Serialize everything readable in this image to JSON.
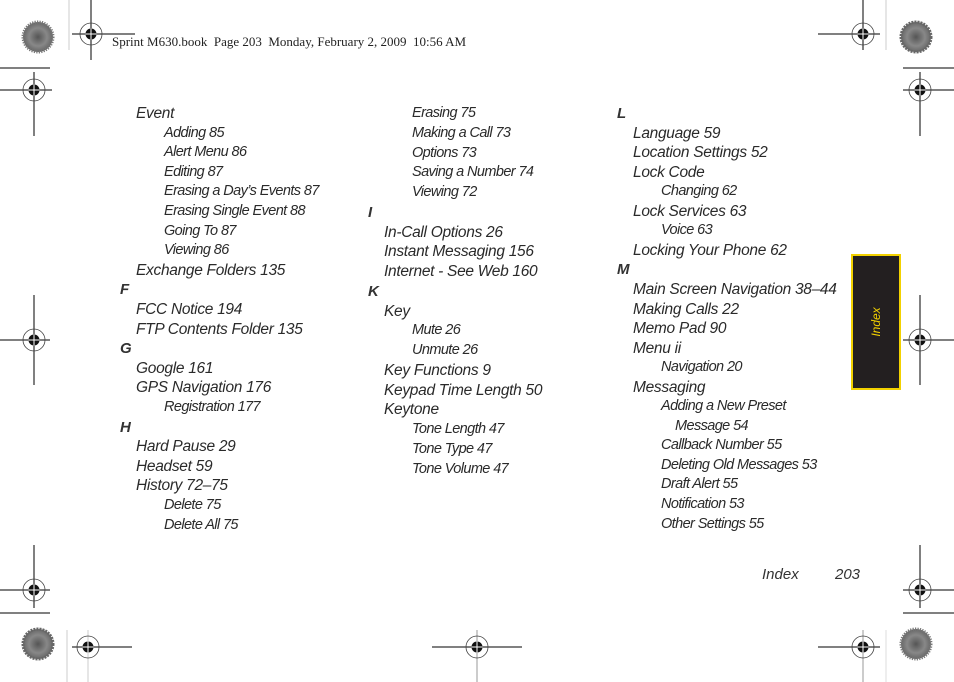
{
  "header": {
    "text": "Sprint M630.book  Page 203  Monday, February 2, 2009  10:56 AM"
  },
  "side_tab": {
    "label": "Index",
    "bg_color": "#231f20",
    "accent_color": "#f2d100"
  },
  "footer": {
    "section": "Index",
    "page_number": "203"
  },
  "columns": [
    {
      "entries": [
        {
          "level": 1,
          "text": "Event"
        },
        {
          "level": 2,
          "text": "Adding 85"
        },
        {
          "level": 2,
          "text": "Alert Menu 86"
        },
        {
          "level": 2,
          "text": "Editing 87"
        },
        {
          "level": 2,
          "text": "Erasing a Day’s Events 87"
        },
        {
          "level": 2,
          "text": "Erasing Single Event 88"
        },
        {
          "level": 2,
          "text": "Going To 87"
        },
        {
          "level": 2,
          "text": "Viewing 86"
        },
        {
          "level": 1,
          "text": "Exchange Folders 135"
        },
        {
          "level": 0,
          "text": "F"
        },
        {
          "level": 1,
          "text": "FCC Notice 194"
        },
        {
          "level": 1,
          "text": "FTP Contents Folder 135"
        },
        {
          "level": 0,
          "text": "G"
        },
        {
          "level": 1,
          "text": "Google 161"
        },
        {
          "level": 1,
          "text": "GPS Navigation 176"
        },
        {
          "level": 2,
          "text": "Registration 177"
        },
        {
          "level": 0,
          "text": "H"
        },
        {
          "level": 1,
          "text": "Hard Pause 29"
        },
        {
          "level": 1,
          "text": "Headset 59"
        },
        {
          "level": 1,
          "text": "History 72–75"
        },
        {
          "level": 2,
          "text": "Delete 75"
        },
        {
          "level": 2,
          "text": "Delete All 75"
        }
      ]
    },
    {
      "entries": [
        {
          "level": 2,
          "text": "Erasing 75"
        },
        {
          "level": 2,
          "text": "Making a Call 73"
        },
        {
          "level": 2,
          "text": "Options 73"
        },
        {
          "level": 2,
          "text": "Saving a Number 74"
        },
        {
          "level": 2,
          "text": "Viewing 72"
        },
        {
          "level": 0,
          "text": "I"
        },
        {
          "level": 1,
          "text": "In-Call Options 26"
        },
        {
          "level": 1,
          "text": "Instant Messaging 156"
        },
        {
          "level": 1,
          "text": "Internet - See Web 160"
        },
        {
          "level": 0,
          "text": "K"
        },
        {
          "level": 1,
          "text": "Key"
        },
        {
          "level": 2,
          "text": "Mute 26"
        },
        {
          "level": 2,
          "text": "Unmute 26"
        },
        {
          "level": 1,
          "text": "Key Functions 9"
        },
        {
          "level": 1,
          "text": "Keypad Time Length 50"
        },
        {
          "level": 1,
          "text": "Keytone"
        },
        {
          "level": 2,
          "text": "Tone Length 47"
        },
        {
          "level": 2,
          "text": "Tone Type 47"
        },
        {
          "level": 2,
          "text": "Tone Volume 47"
        }
      ]
    },
    {
      "entries": [
        {
          "level": 0,
          "text": "L"
        },
        {
          "level": 1,
          "text": "Language 59"
        },
        {
          "level": 1,
          "text": "Location Settings 52"
        },
        {
          "level": 1,
          "text": "Lock Code"
        },
        {
          "level": 2,
          "text": "Changing 62"
        },
        {
          "level": 1,
          "text": "Lock Services 63"
        },
        {
          "level": 2,
          "text": "Voice 63"
        },
        {
          "level": 1,
          "text": "Locking Your Phone 62"
        },
        {
          "level": 0,
          "text": "M"
        },
        {
          "level": 1,
          "text": "Main Screen Navigation 38–44"
        },
        {
          "level": 1,
          "text": "Making Calls 22"
        },
        {
          "level": 1,
          "text": "Memo Pad 90"
        },
        {
          "level": 1,
          "text": "Menu ii"
        },
        {
          "level": 2,
          "text": "Navigation 20"
        },
        {
          "level": 1,
          "text": "Messaging"
        },
        {
          "level": 2,
          "text": "Adding a New Preset"
        },
        {
          "level": 3,
          "text": "Message 54"
        },
        {
          "level": 2,
          "text": "Callback Number 55"
        },
        {
          "level": 2,
          "text": "Deleting Old Messages 53"
        },
        {
          "level": 2,
          "text": "Draft Alert 55"
        },
        {
          "level": 2,
          "text": "Notification 53"
        },
        {
          "level": 2,
          "text": "Other Settings 55"
        }
      ]
    }
  ]
}
